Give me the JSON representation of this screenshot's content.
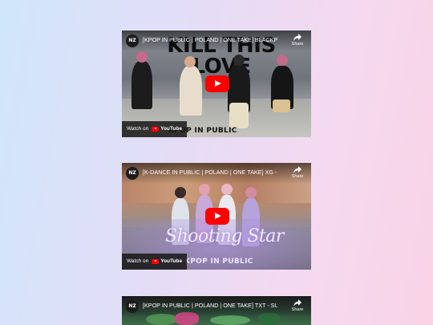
{
  "videos": [
    {
      "channel_badge": "NZ",
      "title": "[KPOP IN PUBLIC | POLAND | ONE TAKE] BLACKPI...",
      "share_label": "Share",
      "watch_label": "Watch on",
      "youtube_label": "YouTube",
      "overlay_text": "KILL THIS LOVE",
      "brand_text": "KPOP IN PUBLIC",
      "brand_color": "#111111"
    },
    {
      "channel_badge": "NZ",
      "title": "[K-DANCE IN PUBLIC | POLAND | ONE TAKE] XG - S...",
      "share_label": "Share",
      "watch_label": "Watch on",
      "youtube_label": "YouTube",
      "overlay_text": "Shooting Star",
      "brand_text": "KPOP IN PUBLIC",
      "brand_color": "#e7d8ff"
    },
    {
      "channel_badge": "NZ",
      "title": "[KPOP IN PUBLIC | POLAND | ONE TAKE] TXT - SUG...",
      "share_label": "Share"
    }
  ],
  "colors": {
    "play_button": "#ff0000",
    "page_gradient_start": "#cfe6fb",
    "page_gradient_end": "#f9d3e6"
  }
}
